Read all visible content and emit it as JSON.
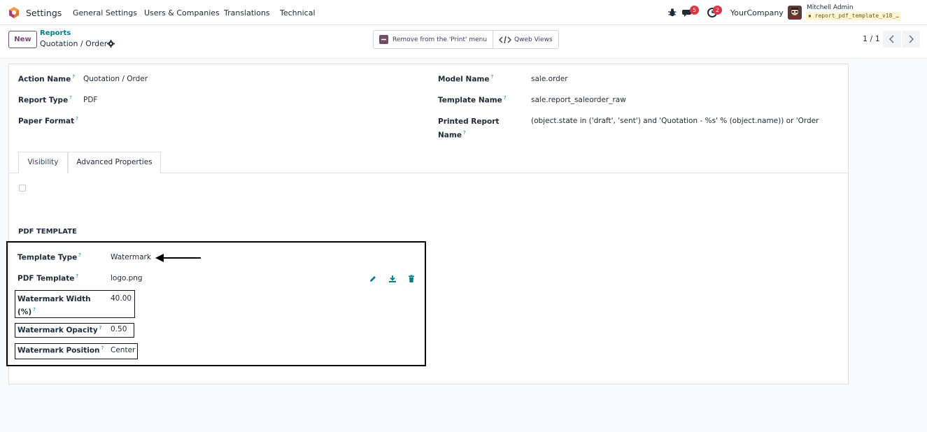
{
  "navbar": {
    "app_title": "Settings",
    "menu": [
      "General Settings",
      "Users & Companies",
      "Translations",
      "Technical"
    ],
    "messages_badge": "5",
    "activities_badge": "2",
    "company": "YourCompany",
    "user_name": "Mitchell Admin",
    "database": "report_pdf_template_v18_…"
  },
  "control": {
    "new_label": "New",
    "breadcrumb_parent": "Reports",
    "breadcrumb_current": "Quotation / Order",
    "remove_print_label": "Remove from the 'Print' menu",
    "qweb_views_label": "Qweb Views",
    "pager": "1 / 1"
  },
  "form": {
    "action_name_label": "Action Name",
    "action_name_value": "Quotation / Order",
    "report_type_label": "Report Type",
    "report_type_value": "PDF",
    "paper_format_label": "Paper Format",
    "model_name_label": "Model Name",
    "model_name_value": "sale.order",
    "template_name_label": "Template Name",
    "template_name_value": "sale.report_saleorder_raw",
    "printed_report_label_1": "Printed Report",
    "printed_report_label_2": "Name",
    "printed_report_value": "(object.state in ('draft', 'sent') and 'Quotation - %s' % (object.name)) or 'Order - %s",
    "help_mark": "?"
  },
  "tabs": [
    "Visibility",
    "Advanced Properties"
  ],
  "pdf_template": {
    "section_title": "PDF TEMPLATE",
    "template_type_label": "Template Type",
    "template_type_value": "Watermark",
    "pdf_template_label": "PDF Template",
    "pdf_template_value": "logo.png",
    "watermark_width_label_1": "Watermark Width",
    "watermark_width_label_2": "(%)",
    "watermark_width_value": "40.00",
    "watermark_opacity_label": "Watermark Opacity",
    "watermark_opacity_value": "0.50",
    "watermark_position_label": "Watermark Position",
    "watermark_position_value": "Center"
  },
  "colors": {
    "brand": "#714b67",
    "accent": "#017e84",
    "badge": "#dc3545"
  },
  "icons": {
    "edit": "pencil-icon",
    "download": "download-icon",
    "delete": "trash-icon"
  }
}
